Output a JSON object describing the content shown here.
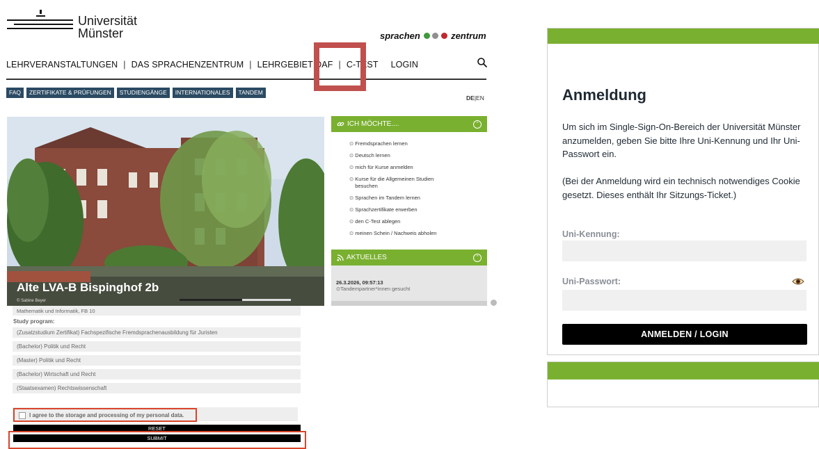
{
  "site": {
    "university_line1": "Universität",
    "university_line2": "Münster",
    "center_logo_left": "sprachen",
    "center_logo_right": "zentrum",
    "colors": {
      "green": "#7ab030",
      "dot1": "#3e9a3a",
      "dot2": "#8f8f8f",
      "dot3": "#c1272d",
      "highlight": "#c0504d",
      "outline": "#d9442a"
    },
    "nav": [
      "LEHRVERANSTALTUNGEN",
      "DAS SPRACHENZENTRUM",
      "LEHRGEBIET DAF",
      "C-TEST",
      "LOGIN"
    ],
    "search_icon": "search-icon",
    "subnav": [
      "FAQ",
      "ZERTIFIKATE & PRÜFUNGEN",
      "STUDIENGÄNGE",
      "INTERNATIONALES",
      "TANDEM"
    ],
    "lang_active": "DE",
    "lang_sep": "|",
    "lang_other": "EN",
    "hero": {
      "caption": "Alte LVA-B Bispinghof 2b",
      "credit": "© Sabine Beyer"
    },
    "want_widget": {
      "title": "ICH MÖCHTE....",
      "items": [
        "Fremdsprachen lernen",
        "Deutsch lernen",
        "mich für Kurse anmelden",
        "Kurse für die Allgemeinen Studien besuchen",
        "Sprachen im Tandem lernen",
        "Sprachzertifikate erwerben",
        "den C-Test ablegen",
        "meinen Schein / Nachweis abholen"
      ]
    },
    "news_widget": {
      "title": "AKTUELLES",
      "date": "26.3.2026, 09:57:13",
      "item": "Tandempartner*innen gesucht"
    }
  },
  "form": {
    "faculty": "Mathematik und Informatik, FB 10",
    "study_label": "Study program:",
    "programs": [
      "(Zusatzstudium Zertifikat) Fachspezifische Fremdsprachenausbildung für Juristen",
      "(Bachelor) Politik und Recht",
      "(Master) Politik und Recht",
      "(Bachelor) Wirtschaft und Recht",
      "(Staatsexamen) Rechtswissenschaft"
    ],
    "consent": "I agree to the storage and processing of my personal data.",
    "reset": "RESET",
    "submit": "SUBMIT"
  },
  "login": {
    "title": "Anmeldung",
    "intro": "Um sich im Single-Sign-On-Bereich der Universität Münster anzumelden, geben Sie bitte Ihre Uni-Kennung und Ihr Uni-Passwort ein.",
    "cookie_note": "(Bei der Anmeldung wird ein technisch notwendiges Cookie gesetzt. Dieses enthält Ihr Sitzungs-Ticket.)",
    "user_label": "Uni-Kennung:",
    "user_value": "",
    "pass_label": "Uni-Passwort:",
    "pass_value": "",
    "show_password_icon": "eye-icon",
    "button": "ANMELDEN / LOGIN"
  }
}
